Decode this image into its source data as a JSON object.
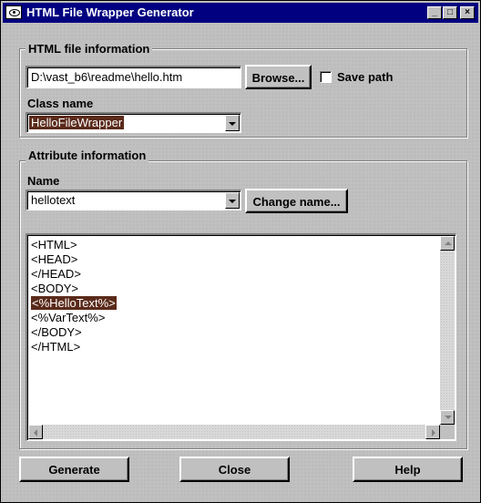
{
  "window": {
    "title": "HTML File Wrapper Generator",
    "minimize_glyph": "_",
    "maximize_glyph": "□",
    "close_glyph": "×"
  },
  "file_info": {
    "group_label": "HTML file information",
    "path_value": "D:\\vast_b6\\readme\\hello.htm",
    "browse_label": "Browse...",
    "save_path_label": "Save path",
    "save_path_checked": false,
    "class_name_label": "Class name",
    "class_name_value": "HelloFileWrapper"
  },
  "attribute_info": {
    "group_label": "Attribute information",
    "name_label": "Name",
    "name_value": "hellotext",
    "change_name_label": "Change name...",
    "code_lines": [
      "<HTML>",
      "<HEAD>",
      "</HEAD>",
      "<BODY>",
      "<%HelloText%>",
      "<%VarText%>",
      "</BODY>",
      "</HTML>"
    ],
    "highlighted_line": "<%HelloText%>"
  },
  "buttons": {
    "generate_label": "Generate",
    "close_label": "Close",
    "help_label": "Help"
  },
  "colors": {
    "title_bar": "#000080",
    "selection": "#5a2a1a",
    "face": "#c0c0c0"
  }
}
